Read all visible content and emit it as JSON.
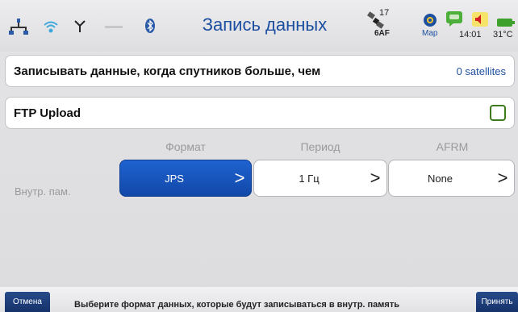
{
  "statusbar": {
    "title": "Запись данных",
    "satellite_count": "17",
    "satellite_label": "6AF",
    "map_label": "Map",
    "time": "14:01",
    "temperature": "31°C",
    "icons": [
      "network-icon",
      "wifi-icon",
      "antenna-icon",
      "bluetooth-icon",
      "satellite-icon",
      "map-icon",
      "chat-icon",
      "speaker-icon",
      "battery-icon"
    ]
  },
  "rows": {
    "record_label": "Записывать данные, когда спутников больше, чем",
    "record_value": "0 satellites",
    "ftp_label": "FTP Upload"
  },
  "table": {
    "headers": [
      "Формат",
      "Период",
      "AFRM"
    ],
    "row_label": "Внутр. пам.",
    "format_value": "JPS",
    "period_value": "1 Гц",
    "afrm_value": "None",
    "chevron": ">"
  },
  "bottom": {
    "cancel_label": "Отмена",
    "accept_label": "Принять",
    "hint": "Выберите формат данных, которые будут записываться в внутр. память"
  },
  "colors": {
    "accent": "#1d4fa0",
    "active_button": "#1f62d0",
    "checkbox_border": "#3b7a1f",
    "bottom_button": "#274a8a"
  }
}
